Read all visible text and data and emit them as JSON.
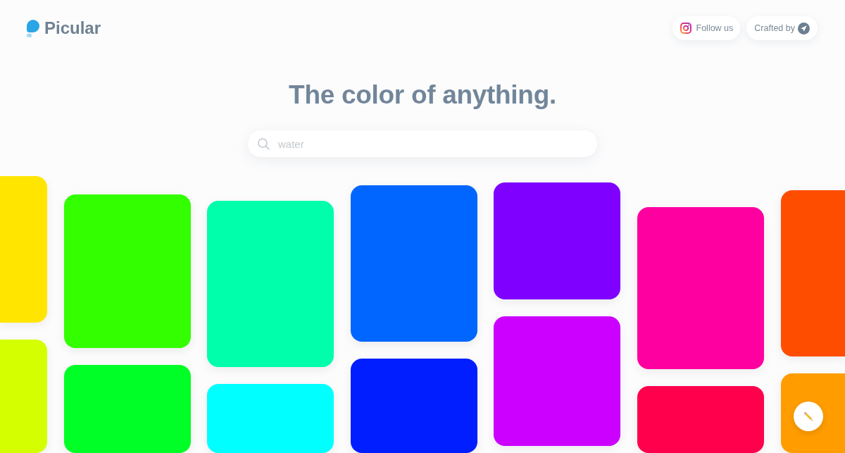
{
  "header": {
    "logo": "Picular",
    "buttons": [
      {
        "kind": "instagram",
        "label": "Follow us"
      },
      {
        "kind": "crafted",
        "label": "Crafted by"
      }
    ]
  },
  "headline": "The color of anything.",
  "search": {
    "placeholder": "water"
  },
  "columns": [
    {
      "tiles": [
        {
          "color": "#ffe500"
        },
        {
          "color": "#d4ff00"
        }
      ]
    },
    {
      "tiles": [
        {
          "color": "#33ff00"
        },
        {
          "color": "#00ff26"
        }
      ]
    },
    {
      "tiles": [
        {
          "color": "#00ffaa"
        },
        {
          "color": "#00ffff"
        }
      ]
    },
    {
      "tiles": [
        {
          "color": "#0066ff"
        },
        {
          "color": "#001eff"
        }
      ]
    },
    {
      "tiles": [
        {
          "color": "#7f00ff"
        },
        {
          "color": "#cc00ff"
        }
      ]
    },
    {
      "tiles": [
        {
          "color": "#ff00a0"
        },
        {
          "color": "#ff004c"
        }
      ]
    },
    {
      "tiles": [
        {
          "color": "#ff4d00"
        },
        {
          "color": "#ff9d00"
        }
      ]
    }
  ]
}
